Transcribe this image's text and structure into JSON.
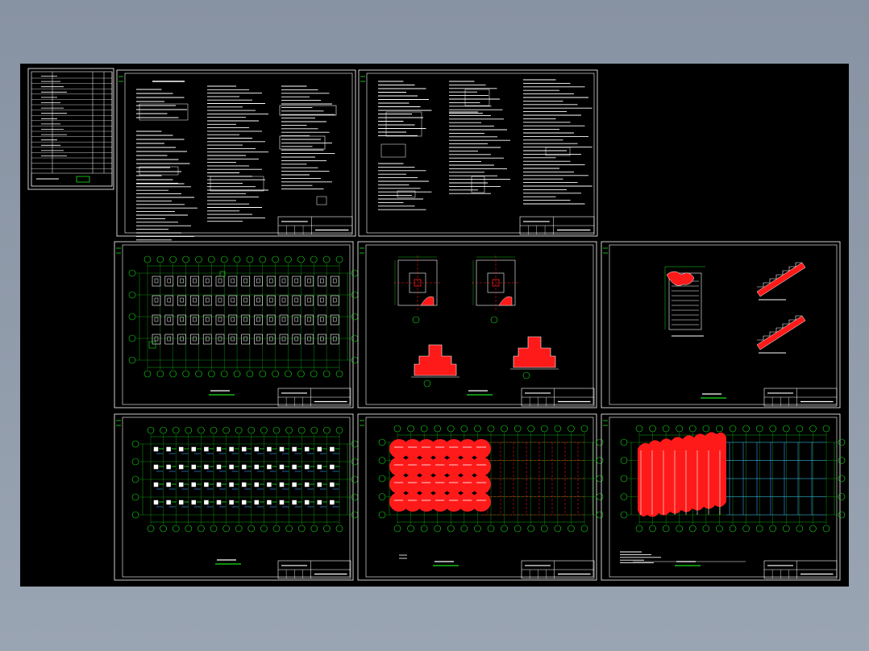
{
  "viewer": {
    "background_color": "#8b96a6",
    "canvas_color": "#000000",
    "sheet_frame_color": "#ffffff",
    "line_colors": {
      "text": "#ffffff",
      "grid_bubble": "#18e018",
      "dim": "#18e018",
      "fill": "#ff1a1a",
      "hidden": "#3aa0ff",
      "title": "#18e018"
    }
  },
  "sheets": [
    {
      "id": "drawing-index",
      "type": "index"
    },
    {
      "id": "general-notes-1",
      "type": "notes"
    },
    {
      "id": "general-notes-2",
      "type": "notes"
    },
    {
      "id": "foundation-plan",
      "type": "foundation"
    },
    {
      "id": "foundation-details",
      "type": "details"
    },
    {
      "id": "stair-details",
      "type": "stair"
    },
    {
      "id": "column-layout",
      "type": "columns"
    },
    {
      "id": "floor-beam-plan",
      "type": "beams"
    },
    {
      "id": "roof-beam-plan",
      "type": "roof"
    }
  ]
}
